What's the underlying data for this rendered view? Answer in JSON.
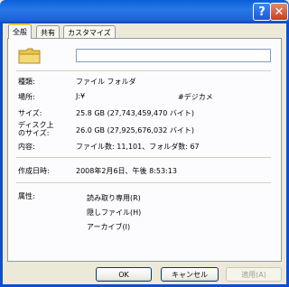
{
  "titlebar": {
    "help_glyph": "?",
    "close_glyph": "✕"
  },
  "tabs": [
    {
      "label": "全般",
      "active": true
    },
    {
      "label": "共有",
      "active": false
    },
    {
      "label": "カスタマイズ",
      "active": false
    }
  ],
  "general": {
    "name_value": "",
    "type": {
      "label": "種類:",
      "value": "ファイル フォルダ"
    },
    "location": {
      "label": "場所:",
      "value": "J:¥",
      "value2": "#デジカメ"
    },
    "size": {
      "label": "サイズ:",
      "value": "25.8 GB (27,743,459,470 バイト)"
    },
    "size_on_disk": {
      "label": "ディスク上\nのサイズ:",
      "value": "26.0 GB (27,925,676,032 バイト)"
    },
    "contents": {
      "label": "内容:",
      "value": "ファイル数: 11,101、フォルダ数: 67"
    },
    "created": {
      "label": "作成日時:",
      "value": "2008年2月6日、午後 8:53:13"
    },
    "attributes": {
      "label": "属性:",
      "readonly": "読み取り専用(R)",
      "hidden": "隠しファイル(H)",
      "archive": "アーカイブ(I)"
    }
  },
  "buttons": {
    "ok": "OK",
    "cancel": "キャンセル",
    "apply": "適用(A)"
  }
}
